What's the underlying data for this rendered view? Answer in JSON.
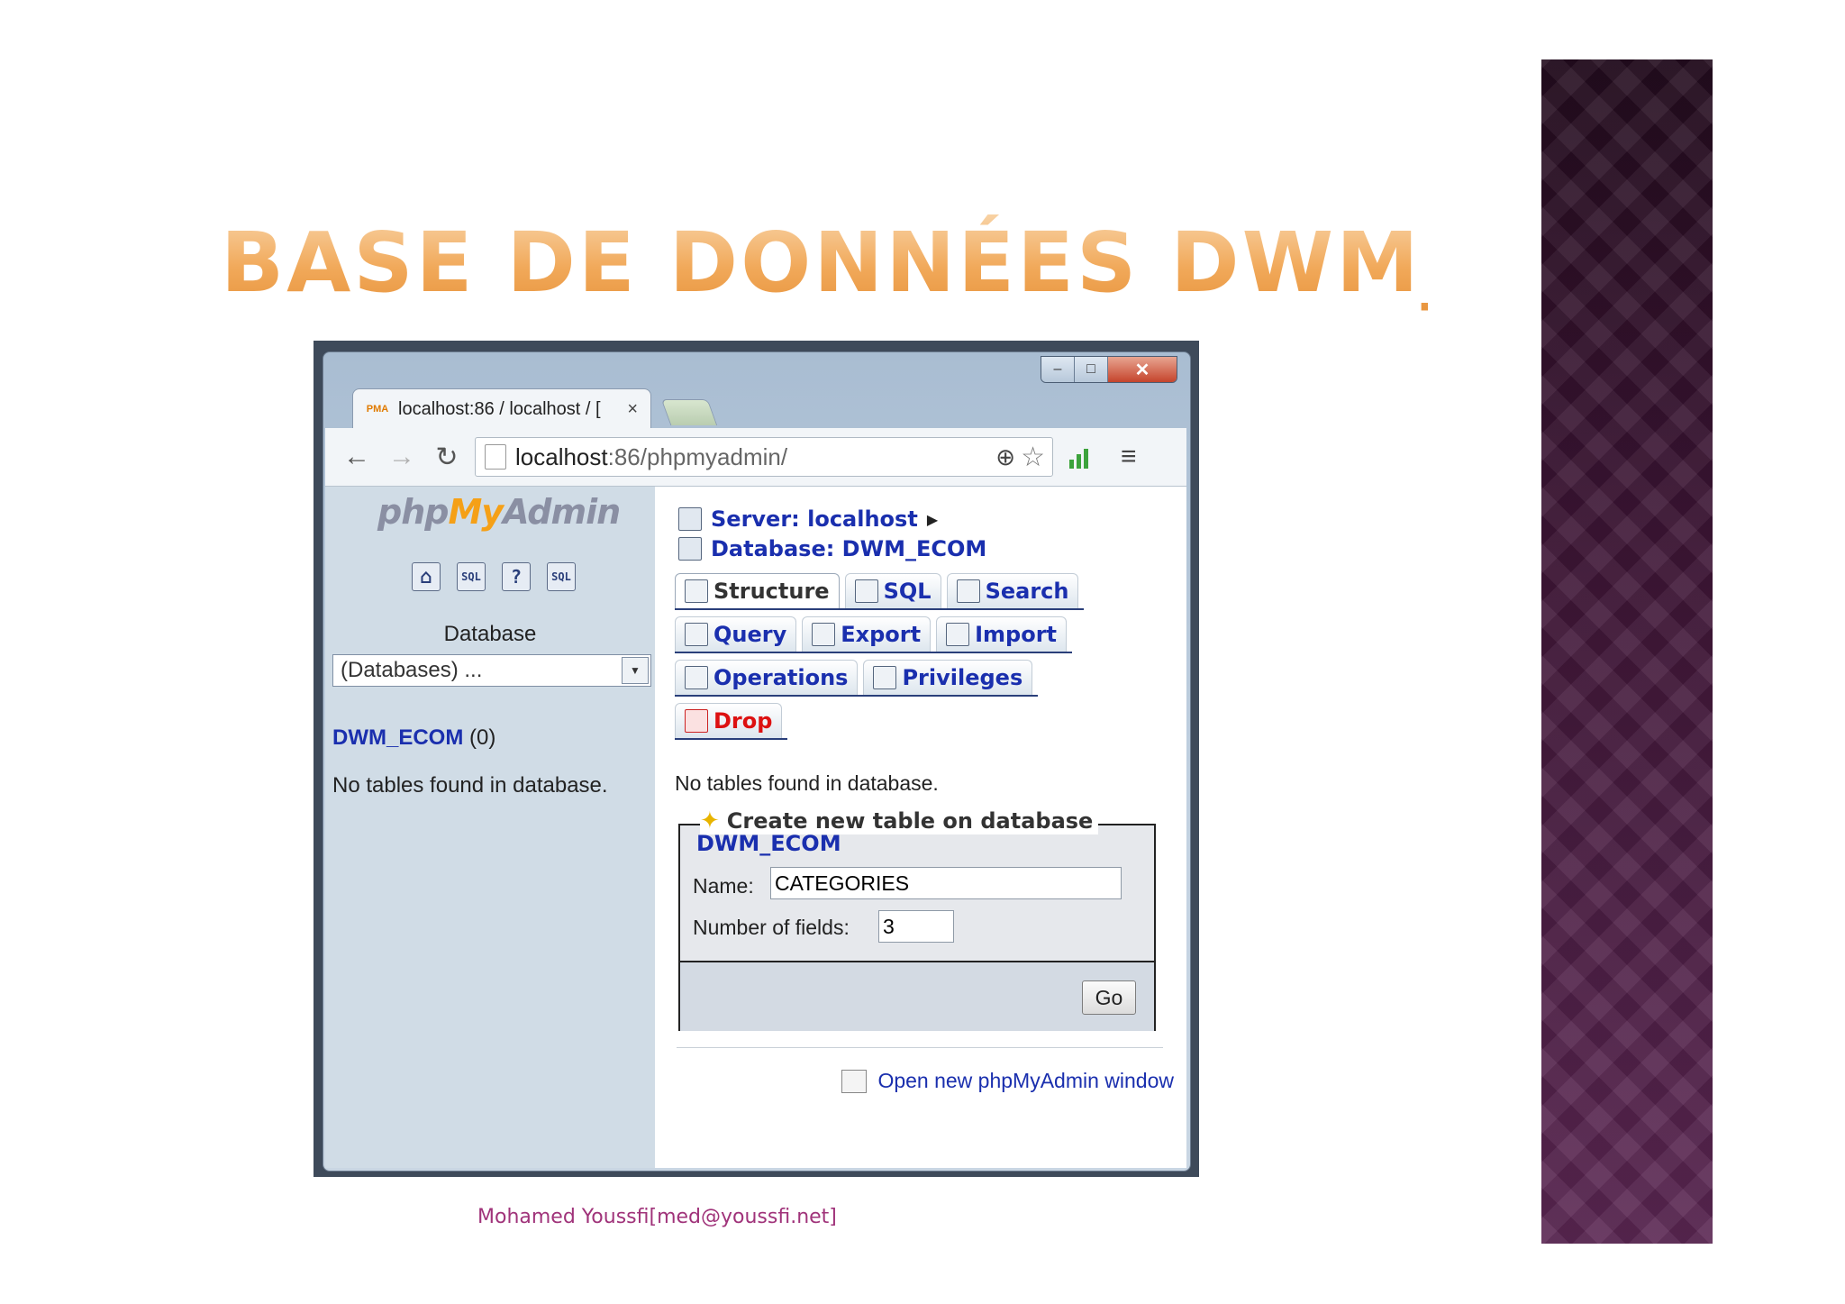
{
  "slide": {
    "title": "BASE DE DONNÉES DWM_ECOM",
    "footer": "Mohamed Youssfi[med@youssfi.net]"
  },
  "browser": {
    "tab_title": "localhost:86 / localhost / [",
    "favicon_text": "PMA",
    "tab_close": "×",
    "url_host": "localhost",
    "url_rest": ":86/phpmyadmin/",
    "window_controls": {
      "minimize": "–",
      "maximize": "□",
      "close": "✕"
    },
    "nav": {
      "back": "←",
      "forward": "→",
      "reload": "↻"
    }
  },
  "sidebar": {
    "logo_php": "php",
    "logo_my": "My",
    "logo_admin": "Admin",
    "icons": [
      "home-icon",
      "sql-icon",
      "help-icon",
      "query-window-icon"
    ],
    "icon_labels": [
      "⌂",
      "SQL",
      "?",
      "SQL"
    ],
    "database_label": "Database",
    "select_value": "(Databases) ...",
    "db_name": "DWM_ECOM",
    "db_count": "(0)",
    "empty_message": "No tables found in database."
  },
  "main": {
    "server_crumb": "Server: localhost",
    "database_crumb": "Database: DWM_ECOM",
    "tabs": [
      {
        "label": "Structure",
        "icon": "structure-icon",
        "active": true
      },
      {
        "label": "SQL",
        "icon": "sql-icon"
      },
      {
        "label": "Search",
        "icon": "search-icon"
      },
      {
        "label": "Query",
        "icon": "query-icon"
      },
      {
        "label": "Export",
        "icon": "export-icon"
      },
      {
        "label": "Import",
        "icon": "import-icon"
      },
      {
        "label": "Operations",
        "icon": "operations-icon"
      },
      {
        "label": "Privileges",
        "icon": "privileges-icon"
      },
      {
        "label": "Drop",
        "icon": "drop-icon"
      }
    ],
    "empty_message": "No tables found in database.",
    "create_legend": "Create new table on database",
    "create_db": "DWM_ECOM",
    "name_label": "Name:",
    "name_value": "CATEGORIES",
    "fields_label": "Number of fields:",
    "fields_value": "3",
    "go_label": "Go",
    "new_window_link": "Open new phpMyAdmin window"
  }
}
